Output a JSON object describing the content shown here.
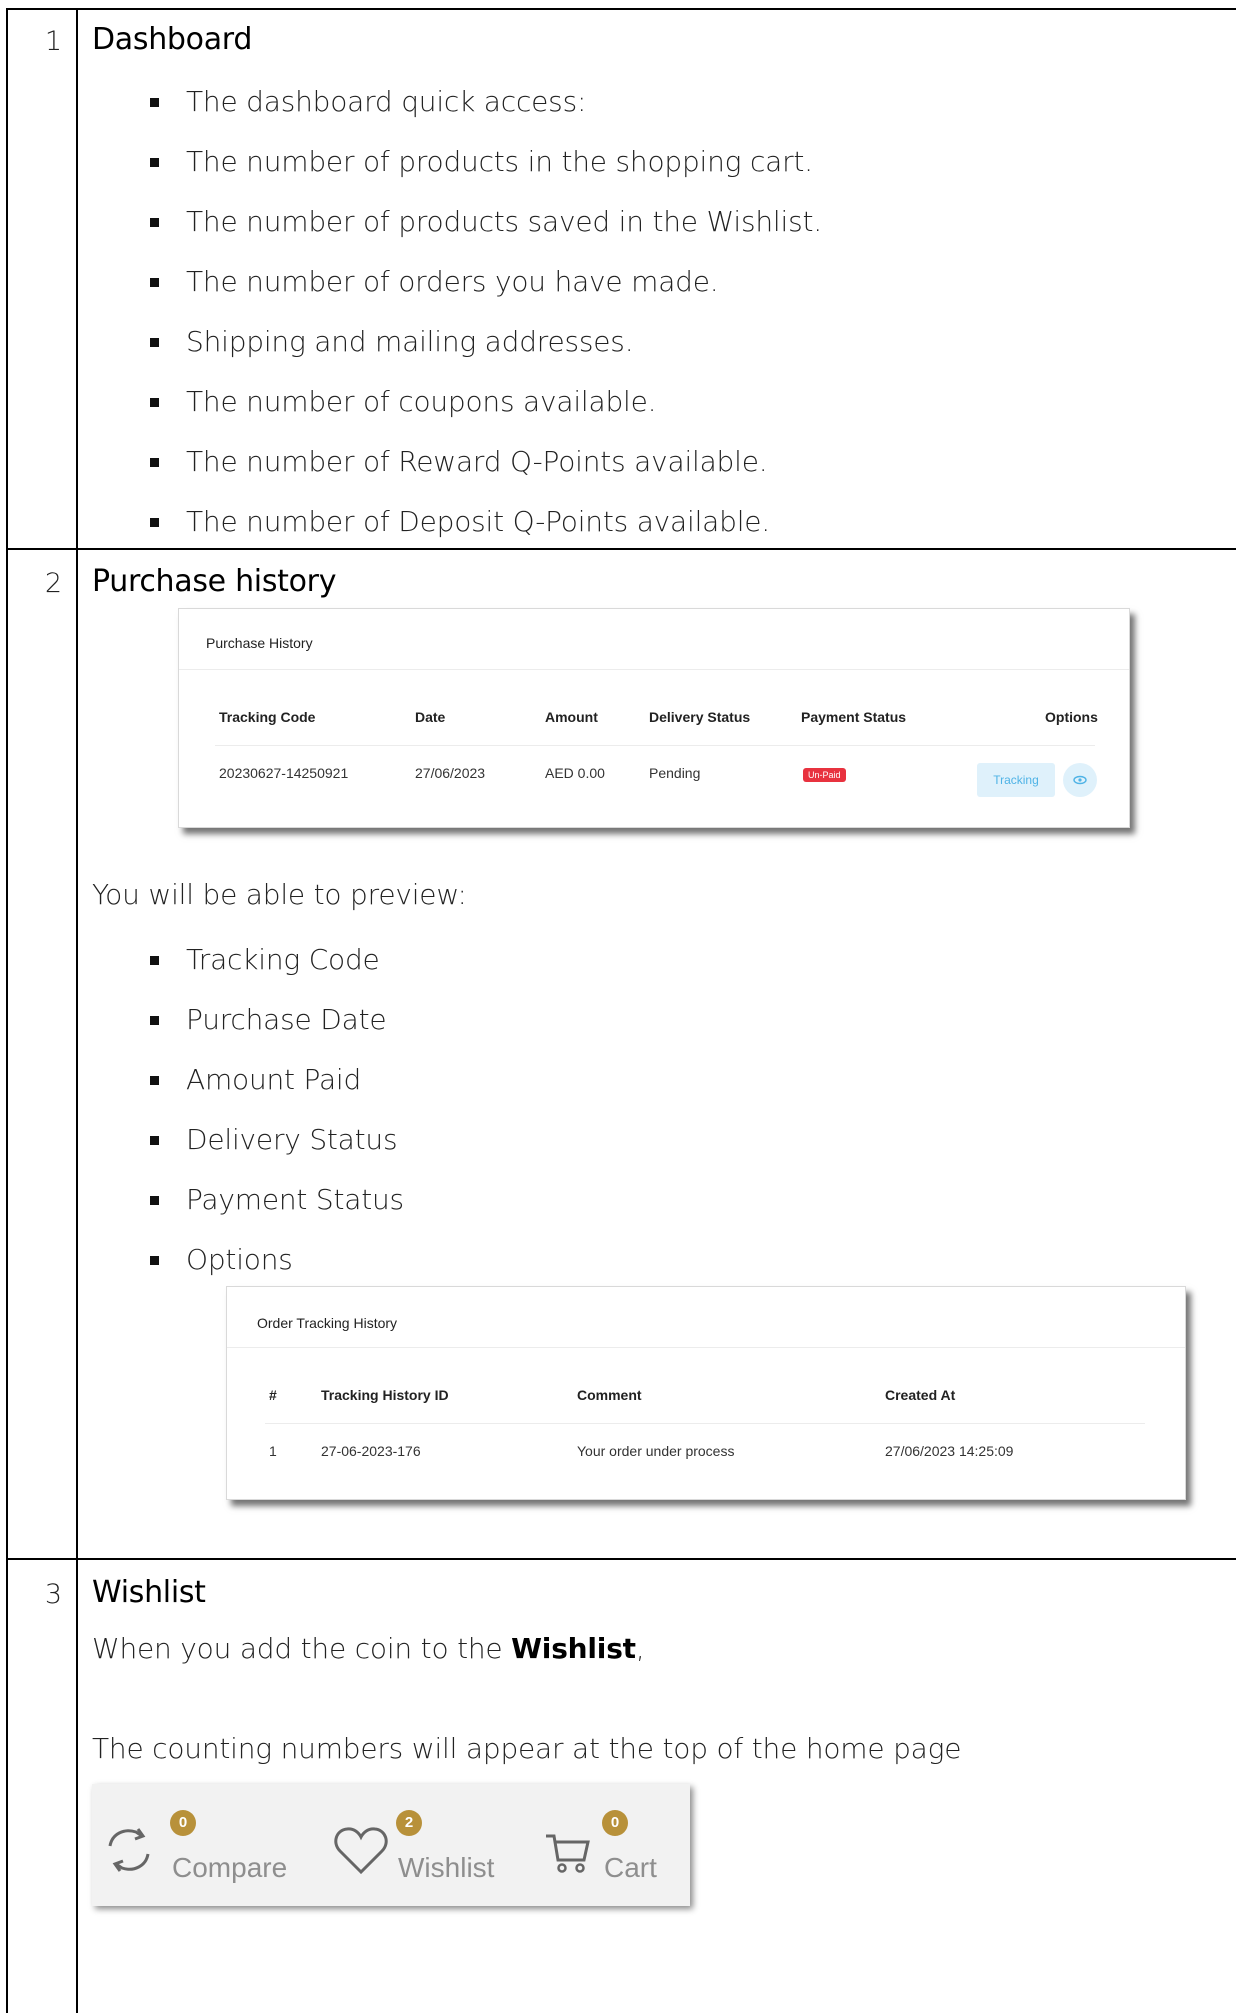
{
  "sections": [
    {
      "number": "1",
      "title": "Dashboard",
      "bullets": [
        "The dashboard quick access:",
        "The number of products in the shopping cart.",
        "The number of products saved in the Wishlist.",
        "The number of orders you have made.",
        "Shipping and mailing addresses.",
        "The number of coupons available.",
        "The number of Reward Q-Points available.",
        "The number of Deposit Q-Points available."
      ]
    },
    {
      "number": "2",
      "title": "Purchase history",
      "purchase_history": {
        "title": "Purchase History",
        "columns": [
          "Tracking Code",
          "Date",
          "Amount",
          "Delivery Status",
          "Payment Status",
          "Options"
        ],
        "row": {
          "tracking_code": "20230627-14250921",
          "date": "27/06/2023",
          "amount": "AED 0.00",
          "delivery_status": "Pending",
          "payment_status": "Un-Paid",
          "tracking_button": "Tracking",
          "eye_icon": "eye-icon"
        },
        "colors": {
          "unpaid_badge": "#e8323f",
          "tracking_button_bg": "#dff1fb",
          "tracking_button_text": "#4fb3e6"
        }
      },
      "preview_intro": "You will be able to preview:",
      "preview_bullets": [
        "Tracking Code",
        "Purchase Date",
        "Amount Paid",
        "Delivery Status",
        "Payment Status",
        "Options"
      ],
      "order_tracking": {
        "title": "Order Tracking History",
        "columns": [
          "#",
          "Tracking History ID",
          "Comment",
          "Created At"
        ],
        "row": [
          "1",
          "27-06-2023-176",
          "Your order under process",
          "27/06/2023 14:25:09"
        ]
      }
    },
    {
      "number": "3",
      "title": "Wishlist",
      "para1_prefix": "When you add the coin to the ",
      "para1_bold": "Wishlist",
      "para1_suffix": ",",
      "para2": "The counting numbers will appear at the top of the home page",
      "header_counters": [
        {
          "label": "Compare",
          "count": "0",
          "icon": "compare-icon"
        },
        {
          "label": "Wishlist",
          "count": "2",
          "icon": "heart-icon"
        },
        {
          "label": "Cart",
          "count": "0",
          "icon": "cart-icon"
        }
      ],
      "colors": {
        "count_badge": "#b8913a"
      }
    }
  ]
}
